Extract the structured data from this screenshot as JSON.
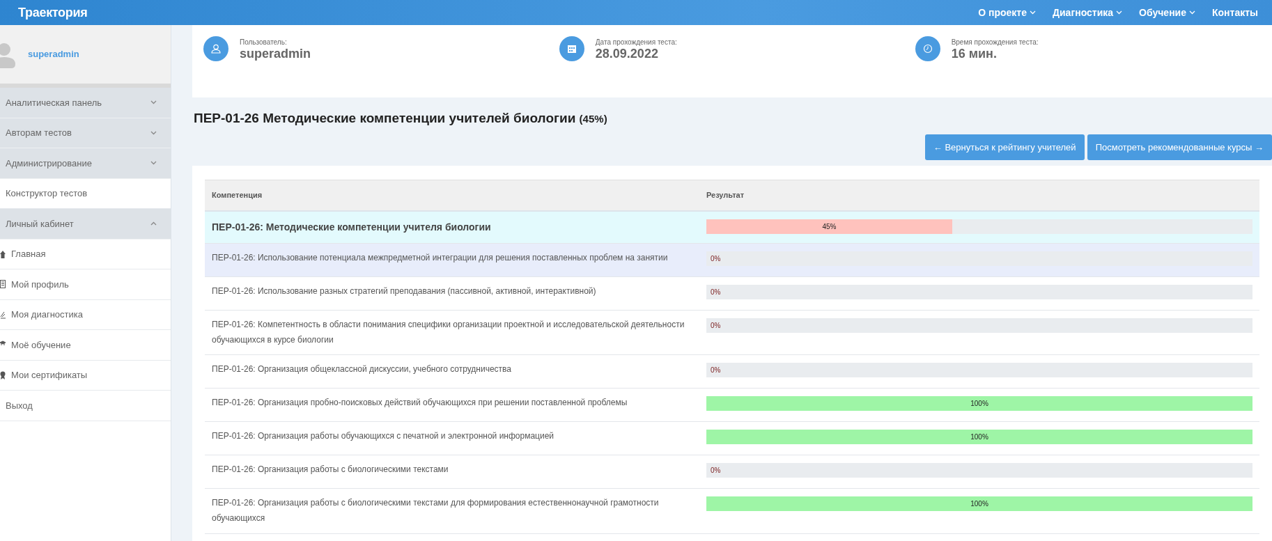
{
  "brand": "Траектория",
  "nav": [
    {
      "label": "О проекте",
      "dropdown": true
    },
    {
      "label": "Диагностика",
      "dropdown": true
    },
    {
      "label": "Обучение",
      "dropdown": true
    },
    {
      "label": "Контакты",
      "dropdown": false
    }
  ],
  "sidebar": {
    "user": "superadmin",
    "items": [
      {
        "kind": "group",
        "label": "Аналитическая панель",
        "expanded": false
      },
      {
        "kind": "group",
        "label": "Авторам тестов",
        "expanded": false
      },
      {
        "kind": "group",
        "label": "Администрирование",
        "expanded": false
      },
      {
        "kind": "link",
        "label": "Конструктор тестов"
      },
      {
        "kind": "group",
        "label": "Личный кабинет",
        "expanded": true
      },
      {
        "kind": "sub",
        "label": "Главная"
      },
      {
        "kind": "sub",
        "label": "Мой профиль"
      },
      {
        "kind": "sub",
        "label": "Моя диагностика"
      },
      {
        "kind": "sub",
        "label": "Моё обучение"
      },
      {
        "kind": "sub",
        "label": "Мои сертификаты"
      },
      {
        "kind": "link",
        "label": "Выход"
      }
    ]
  },
  "info": [
    {
      "label": "Пользователь:",
      "value": "superadmin"
    },
    {
      "label": "Дата прохождения теста:",
      "value": "28.09.2022"
    },
    {
      "label": "Время прохождения теста:",
      "value": "16 мин."
    }
  ],
  "title": "ПЕР-01-26 Методические компетенции учителей биологии",
  "title_score": "(45%)",
  "buttons": [
    {
      "label": "← Вернуться к рейтингу учителей"
    },
    {
      "label": "Посмотреть рекомендованные курсы →"
    }
  ],
  "table": {
    "columns": [
      "Компетенция",
      "Результат"
    ],
    "rows": [
      {
        "kind": "total",
        "highlighted": false,
        "name": "ПЕР-01-26: Методические компетенции учителя биологии",
        "level": 0.45,
        "reading": "45%",
        "color": "#ffc2bd"
      },
      {
        "kind": "item",
        "highlighted": true,
        "name": "ПЕР-01-26: Использование потенциала межпредметной интеграции для решения поставленных проблем на занятии",
        "reading": "0%"
      },
      {
        "kind": "item",
        "highlighted": false,
        "name": "ПЕР-01-26: Использование разных стратегий преподавания (пассивной, активной, интерактивной)",
        "reading": "0%"
      },
      {
        "kind": "item",
        "highlighted": false,
        "name": "ПЕР-01-26: Компетентность в области понимания специфики организации проектной и исследовательской деятельности обучающихся в курсе биологии",
        "reading": "0%"
      },
      {
        "kind": "item",
        "highlighted": false,
        "name": "ПЕР-01-26: Организация общеклассной дискуссии, учебного сотрудничества",
        "reading": "0%"
      },
      {
        "kind": "item",
        "highlighted": false,
        "name": "ПЕР-01-26: Организация пробно-поисковых действий обучающихся при решении поставленной проблемы",
        "level": 1,
        "reading": "100%",
        "color": "#9ef5a6"
      },
      {
        "kind": "item",
        "highlighted": false,
        "name": "ПЕР-01-26: Организация работы обучающихся с печатной и электронной информацией",
        "level": 1,
        "reading": "100%",
        "color": "#9ef5a6"
      },
      {
        "kind": "item",
        "highlighted": false,
        "name": "ПЕР-01-26: Организация работы с биологическими текстами",
        "reading": "0%"
      },
      {
        "kind": "item",
        "highlighted": false,
        "name": "ПЕР-01-26: Организация работы с биологическими текстами для формирования естественнонаучной грамотности обучающихся",
        "level": 1,
        "reading": "100%",
        "color": "#9ef5a6"
      }
    ]
  }
}
